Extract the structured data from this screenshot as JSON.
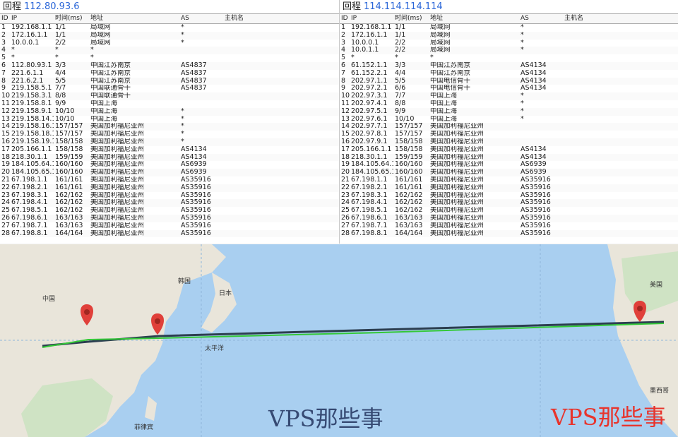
{
  "left_panel": {
    "title": "回程",
    "host": "112.80.93.6",
    "headers": [
      "ID",
      "IP",
      "时间(ms)",
      "地址",
      "AS",
      "主机名"
    ],
    "rows": [
      [
        "1",
        "192.168.1.1",
        "1/1",
        "局域网",
        "*",
        ""
      ],
      [
        "2",
        "172.16.1.1",
        "1/1",
        "局域网",
        "*",
        ""
      ],
      [
        "3",
        "10.0.0.1",
        "2/2",
        "局域网",
        "*",
        ""
      ],
      [
        "4",
        "*",
        "*",
        "*",
        "",
        ""
      ],
      [
        "5",
        "*",
        "*",
        "*",
        "",
        ""
      ],
      [
        "6",
        "112.80.93.1",
        "3/3",
        "中国江苏南京",
        "AS4837",
        ""
      ],
      [
        "7",
        "221.6.1.1",
        "4/4",
        "中国江苏南京",
        "AS4837",
        ""
      ],
      [
        "8",
        "221.6.2.1",
        "5/5",
        "中国江苏南京",
        "AS4837",
        ""
      ],
      [
        "9",
        "219.158.5.1",
        "7/7",
        "中国联通骨干",
        "AS4837",
        ""
      ],
      [
        "10",
        "219.158.3.1",
        "8/8",
        "中国联通骨干",
        "",
        ""
      ],
      [
        "11",
        "219.158.8.1",
        "9/9",
        "中国上海",
        "",
        ""
      ],
      [
        "12",
        "219.158.9.1",
        "10/10",
        "中国上海",
        "*",
        ""
      ],
      [
        "13",
        "219.158.14.1",
        "10/10",
        "中国上海",
        "*",
        ""
      ],
      [
        "14",
        "219.158.16.1",
        "157/157",
        "美国加利福尼亚州",
        "*",
        ""
      ],
      [
        "15",
        "219.158.18.1",
        "157/157",
        "美国加利福尼亚州",
        "*",
        ""
      ],
      [
        "16",
        "219.158.19.1",
        "158/158",
        "美国加利福尼亚州",
        "*",
        ""
      ],
      [
        "17",
        "205.166.1.1",
        "158/158",
        "美国加利福尼亚州",
        "AS4134",
        ""
      ],
      [
        "18",
        "218.30.1.1",
        "159/159",
        "美国加利福尼亚州",
        "AS4134",
        ""
      ],
      [
        "19",
        "184.105.64.1",
        "160/160",
        "美国加利福尼亚州",
        "AS6939",
        ""
      ],
      [
        "20",
        "184.105.65.1",
        "160/160",
        "美国加利福尼亚州",
        "AS6939",
        ""
      ],
      [
        "21",
        "67.198.1.1",
        "161/161",
        "美国加利福尼亚州",
        "AS35916",
        ""
      ],
      [
        "22",
        "67.198.2.1",
        "161/161",
        "美国加利福尼亚州",
        "AS35916",
        ""
      ],
      [
        "23",
        "67.198.3.1",
        "162/162",
        "美国加利福尼亚州",
        "AS35916",
        ""
      ],
      [
        "24",
        "67.198.4.1",
        "162/162",
        "美国加利福尼亚州",
        "AS35916",
        ""
      ],
      [
        "25",
        "67.198.5.1",
        "162/162",
        "美国加利福尼亚州",
        "AS35916",
        ""
      ],
      [
        "26",
        "67.198.6.1",
        "163/163",
        "美国加利福尼亚州",
        "AS35916",
        ""
      ],
      [
        "27",
        "67.198.7.1",
        "163/163",
        "美国加利福尼亚州",
        "AS35916",
        ""
      ],
      [
        "28",
        "67.198.8.1",
        "164/164",
        "美国加利福尼亚州",
        "AS35916",
        ""
      ]
    ]
  },
  "right_panel": {
    "title": "回程",
    "host": "114.114.114.114",
    "headers": [
      "ID",
      "IP",
      "时间(ms)",
      "地址",
      "AS",
      "主机名"
    ],
    "rows": [
      [
        "1",
        "192.168.1.1",
        "1/1",
        "局域网",
        "*",
        ""
      ],
      [
        "2",
        "172.16.1.1",
        "1/1",
        "局域网",
        "*",
        ""
      ],
      [
        "3",
        "10.0.0.1",
        "2/2",
        "局域网",
        "*",
        ""
      ],
      [
        "4",
        "10.0.1.1",
        "2/2",
        "局域网",
        "*",
        ""
      ],
      [
        "5",
        "*",
        "*",
        "*",
        "",
        ""
      ],
      [
        "6",
        "61.152.1.1",
        "3/3",
        "中国江苏南京",
        "AS4134",
        ""
      ],
      [
        "7",
        "61.152.2.1",
        "4/4",
        "中国江苏南京",
        "AS4134",
        ""
      ],
      [
        "8",
        "202.97.1.1",
        "5/5",
        "中国电信骨干",
        "AS4134",
        ""
      ],
      [
        "9",
        "202.97.2.1",
        "6/6",
        "中国电信骨干",
        "AS4134",
        ""
      ],
      [
        "10",
        "202.97.3.1",
        "7/7",
        "中国上海",
        "*",
        ""
      ],
      [
        "11",
        "202.97.4.1",
        "8/8",
        "中国上海",
        "*",
        ""
      ],
      [
        "12",
        "202.97.5.1",
        "9/9",
        "中国上海",
        "*",
        ""
      ],
      [
        "13",
        "202.97.6.1",
        "10/10",
        "中国上海",
        "*",
        ""
      ],
      [
        "14",
        "202.97.7.1",
        "157/157",
        "美国加利福尼亚州",
        "",
        ""
      ],
      [
        "15",
        "202.97.8.1",
        "157/157",
        "美国加利福尼亚州",
        "",
        ""
      ],
      [
        "16",
        "202.97.9.1",
        "158/158",
        "美国加利福尼亚州",
        "",
        ""
      ],
      [
        "17",
        "205.166.1.1",
        "158/158",
        "美国加利福尼亚州",
        "AS4134",
        ""
      ],
      [
        "18",
        "218.30.1.1",
        "159/159",
        "美国加利福尼亚州",
        "AS4134",
        ""
      ],
      [
        "19",
        "184.105.64.1",
        "160/160",
        "美国加利福尼亚州",
        "AS6939",
        ""
      ],
      [
        "20",
        "184.105.65.1",
        "160/160",
        "美国加利福尼亚州",
        "AS6939",
        ""
      ],
      [
        "21",
        "67.198.1.1",
        "161/161",
        "美国加利福尼亚州",
        "AS35916",
        ""
      ],
      [
        "22",
        "67.198.2.1",
        "161/161",
        "美国加利福尼亚州",
        "AS35916",
        ""
      ],
      [
        "23",
        "67.198.3.1",
        "162/162",
        "美国加利福尼亚州",
        "AS35916",
        ""
      ],
      [
        "24",
        "67.198.4.1",
        "162/162",
        "美国加利福尼亚州",
        "AS35916",
        ""
      ],
      [
        "25",
        "67.198.5.1",
        "162/162",
        "美国加利福尼亚州",
        "AS35916",
        ""
      ],
      [
        "26",
        "67.198.6.1",
        "163/163",
        "美国加利福尼亚州",
        "AS35916",
        ""
      ],
      [
        "27",
        "67.198.7.1",
        "163/163",
        "美国加利福尼亚州",
        "AS35916",
        ""
      ],
      [
        "28",
        "67.198.8.1",
        "164/164",
        "美国加利福尼亚州",
        "AS35916",
        ""
      ]
    ]
  },
  "map": {
    "labels": {
      "ocean": "太平洋",
      "japan": "日本",
      "korea": "韩国",
      "china": "中国",
      "usa": "美国",
      "mexico": "墨西哥",
      "philippines": "菲律宾"
    },
    "colors": {
      "ocean": "#a9cff0",
      "land": "#e9e5da",
      "land_green": "#cfe3c4",
      "route_green": "#34c838",
      "route_dark": "#2c3e50",
      "pin": "#e0403a"
    }
  },
  "watermarks": {
    "left": "VPS那些事",
    "right": "VPS那些事"
  }
}
